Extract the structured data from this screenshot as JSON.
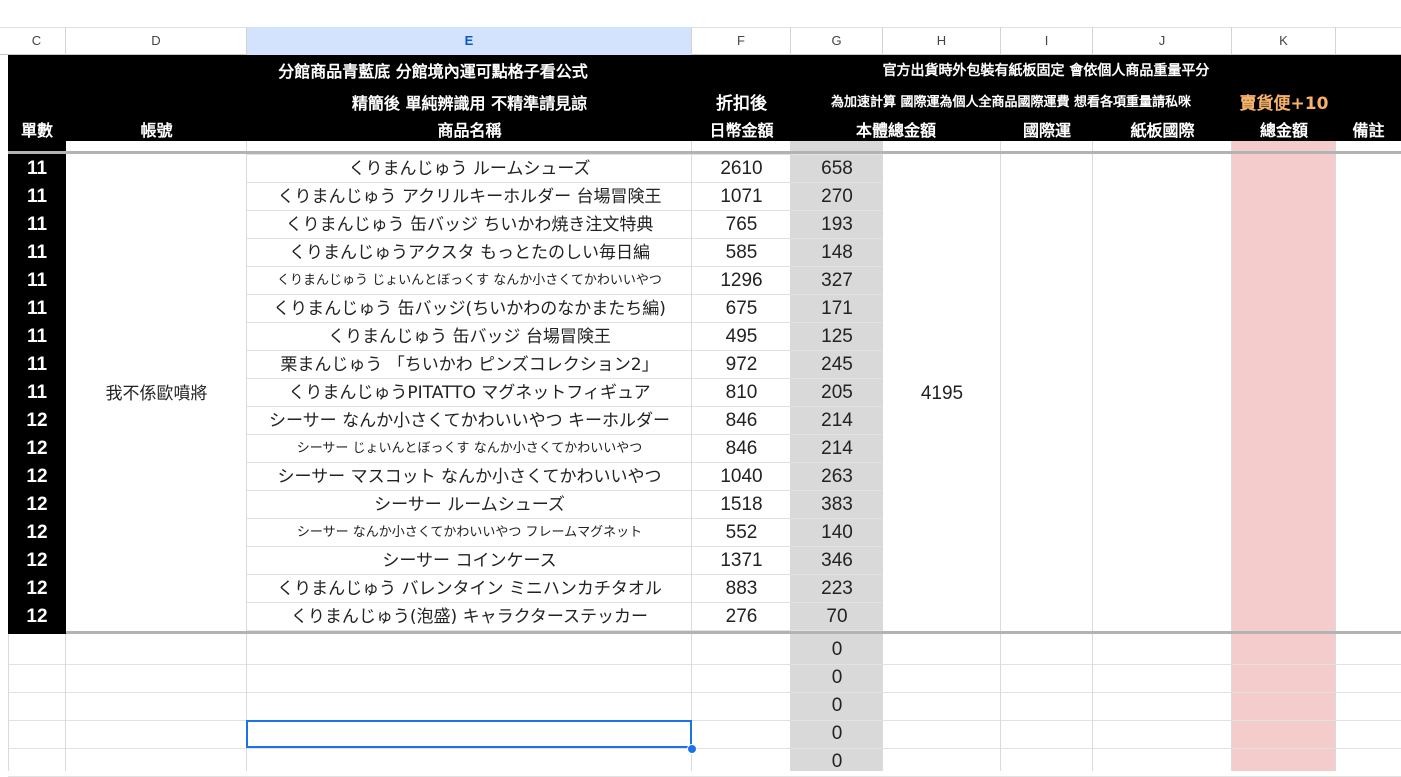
{
  "columns": [
    "C",
    "D",
    "E",
    "F",
    "G",
    "H",
    "I",
    "J",
    "K"
  ],
  "header": {
    "e_line1": "分館商品青藍底 分館境內運可點格子看公式",
    "e_line2": "精簡後 單純辨識用 不精準請見諒",
    "gk_line1": "官方出貨時外包裝有紙板固定 會依個人商品重量平分",
    "gk_line2": "為加速計算 國際運為個人全商品國際運費 想看各項重量請私咪",
    "k_promo": "賣貨便+10",
    "f_line2": "折扣後",
    "labels": {
      "order_count": "單數",
      "account": "帳號",
      "product_name": "商品名稱",
      "jpy_amount": "日幣金額",
      "total_amount": "本體總金額",
      "intl_shipping": "國際運",
      "board_intl": "紙板國際",
      "grand_total": "總金額",
      "notes": "備註"
    }
  },
  "account_name": "我不係歐噴將",
  "total_body": "4195",
  "rows": [
    {
      "count": "11",
      "name": "くりまんじゅう ルームシューズ",
      "jpy": "2610",
      "g": "658",
      "small": false
    },
    {
      "count": "11",
      "name": "くりまんじゅう アクリルキーホルダー 台場冒険王",
      "jpy": "1071",
      "g": "270",
      "small": false
    },
    {
      "count": "11",
      "name": "くりまんじゅう 缶バッジ ちいかわ焼き注文特典",
      "jpy": "765",
      "g": "193",
      "small": false
    },
    {
      "count": "11",
      "name": "くりまんじゅうアクスタ もっとたのしい毎日編",
      "jpy": "585",
      "g": "148",
      "small": false
    },
    {
      "count": "11",
      "name": "くりまんじゅう じょいんとぼっくす なんか小さくてかわいいやつ",
      "jpy": "1296",
      "g": "327",
      "small": true
    },
    {
      "count": "11",
      "name": "くりまんじゅう 缶バッジ(ちいかわのなかまたち編)",
      "jpy": "675",
      "g": "171",
      "small": false
    },
    {
      "count": "11",
      "name": "くりまんじゅう 缶バッジ 台場冒険王",
      "jpy": "495",
      "g": "125",
      "small": false
    },
    {
      "count": "11",
      "name": "栗まんじゅう 「ちいかわ ピンズコレクション2」",
      "jpy": "972",
      "g": "245",
      "small": false
    },
    {
      "count": "11",
      "name": "くりまんじゅうPITATTO マグネットフィギュア",
      "jpy": "810",
      "g": "205",
      "small": false
    },
    {
      "count": "12",
      "name": "シーサー なんか小さくてかわいいやつ キーホルダー",
      "jpy": "846",
      "g": "214",
      "small": false
    },
    {
      "count": "12",
      "name": "シーサー じょいんとぼっくす なんか小さくてかわいいやつ",
      "jpy": "846",
      "g": "214",
      "small": true
    },
    {
      "count": "12",
      "name": "シーサー マスコット なんか小さくてかわいいやつ",
      "jpy": "1040",
      "g": "263",
      "small": false
    },
    {
      "count": "12",
      "name": "シーサー ルームシューズ",
      "jpy": "1518",
      "g": "383",
      "small": false
    },
    {
      "count": "12",
      "name": "シーサー なんか小さくてかわいいやつ フレームマグネット",
      "jpy": "552",
      "g": "140",
      "small": true
    },
    {
      "count": "12",
      "name": "シーサー コインケース",
      "jpy": "1371",
      "g": "346",
      "small": false
    },
    {
      "count": "12",
      "name": "くりまんじゅう バレンタイン ミニハンカチタオル",
      "jpy": "883",
      "g": "223",
      "small": false
    },
    {
      "count": "12",
      "name": "くりまんじゅう(泡盛) キャラクターステッカー",
      "jpy": "276",
      "g": "70",
      "small": false
    }
  ],
  "empty_g_values": [
    "0",
    "0",
    "0",
    "0",
    "0"
  ],
  "colors": {
    "header_bg": "#000000",
    "g_column_bg": "#d9d9d9",
    "k_column_bg": "#f4cccc",
    "promo": "#f6b26b",
    "selection": "#1a73e8"
  }
}
